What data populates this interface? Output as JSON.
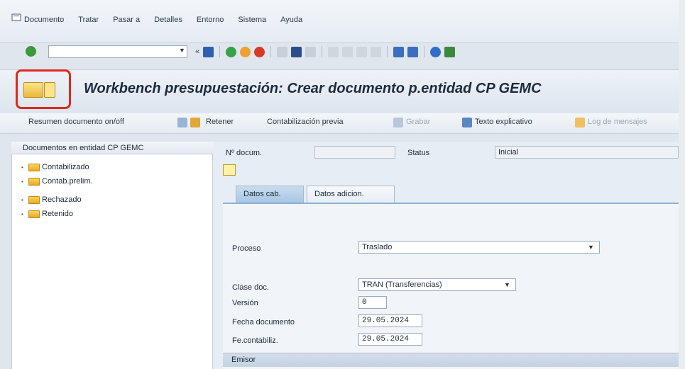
{
  "menu": {
    "items": [
      "Documento",
      "Tratar",
      "Pasar a",
      "Detalles",
      "Entorno",
      "Sistema",
      "Ayuda"
    ]
  },
  "toolbar": {
    "command_value": ""
  },
  "title": "Workbench presupuestación: Crear documento p.entidad CP GEMC",
  "app_toolbar": {
    "summary": "Resumen documento on/off",
    "hold": "Retener",
    "precheck": "Contabilización previa",
    "save": "Grabar",
    "explain": "Texto explicativo",
    "log": "Log de mensajes"
  },
  "tree": {
    "header": "Documentos en entidad CP GEMC",
    "nodes": [
      "Contabilizado",
      "Contab.prelim.",
      "Rechazado",
      "Retenido"
    ]
  },
  "header_fields": {
    "doc_no_label": "Nº docum.",
    "doc_no_value": "",
    "status_label": "Status",
    "status_value": "Inicial"
  },
  "tabs": [
    "Datos cab.",
    "Datos adicion."
  ],
  "form": {
    "process_label": "Proceso",
    "process_value": "Traslado",
    "doc_class_label": "Clase doc.",
    "doc_class_value": "TRAN (Transferencias)",
    "version_label": "Versión",
    "version_value": "0",
    "doc_date_label": "Fecha documento",
    "doc_date_value": "29.05.2024",
    "post_date_label": "Fe.contabiliz.",
    "post_date_value": "29.05.2024",
    "section_label": "Emisor"
  }
}
